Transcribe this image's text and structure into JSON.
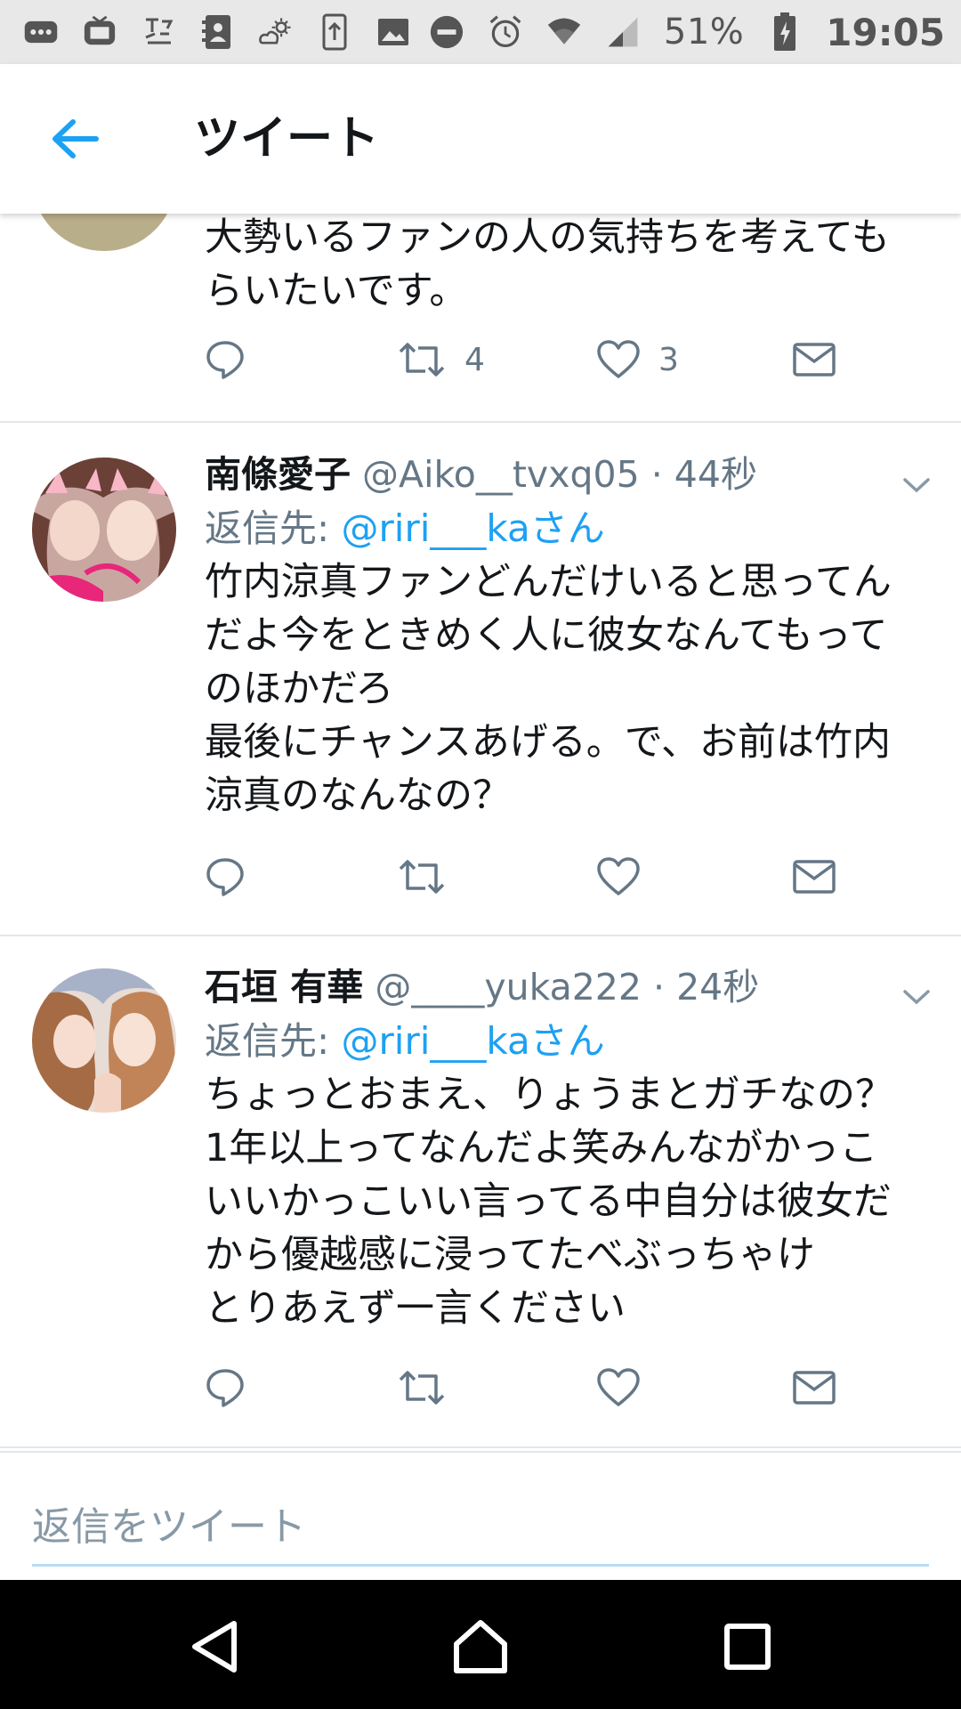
{
  "status_bar": {
    "notification_icons": [
      "more-icon",
      "tv-icon",
      "tweet-bird-icon",
      "contacts-icon",
      "weather-icon",
      "upload-icon",
      "image-icon"
    ],
    "dnd_icon": "do-not-disturb-icon",
    "alarm_icon": "alarm-icon",
    "battery_percent": "51%",
    "time": "19:05"
  },
  "appbar": {
    "title": "ツイート",
    "back_icon": "back-arrow-icon"
  },
  "tweets": [
    {
      "body_lines": [
        "大勢いるファンの人の気持ちを考えても",
        "らいたいです。"
      ],
      "retweet_count": "4",
      "like_count": "3"
    },
    {
      "name": "南條愛子",
      "handle": "@Aiko__tvxq05",
      "time": "· 44秒",
      "reply_prefix": "返信先: ",
      "reply_mention": "@riri___kaさん",
      "body_lines": [
        "竹内涼真ファンどんだけいると思ってん",
        "だよ今をときめく人に彼女なんてもって",
        "のほかだろ",
        "最後にチャンスあげる。で、お前は竹内",
        "涼真のなんなの？"
      ]
    },
    {
      "name": "石垣 有華",
      "handle": "@____yuka222",
      "time": "· 24秒",
      "reply_prefix": "返信先: ",
      "reply_mention": "@riri___kaさん",
      "body_lines": [
        "ちょっとおまえ、りょうまとガチなの？",
        "1年以上ってなんだよ笑みんながかっこ",
        "いいかっこいい言ってる中自分は彼女だ",
        "から優越感に浸ってたべぶっちゃけ",
        "とりあえず一言ください"
      ]
    }
  ],
  "reply_bar": {
    "placeholder": "返信をツイート"
  },
  "colors": {
    "accent": "#1da1f2",
    "text": "#14171a",
    "secondary_text": "#657786",
    "divider": "#e1e8ed",
    "status_bar_bg": "#e8e8e8",
    "nav_bar_bg": "#000000"
  }
}
